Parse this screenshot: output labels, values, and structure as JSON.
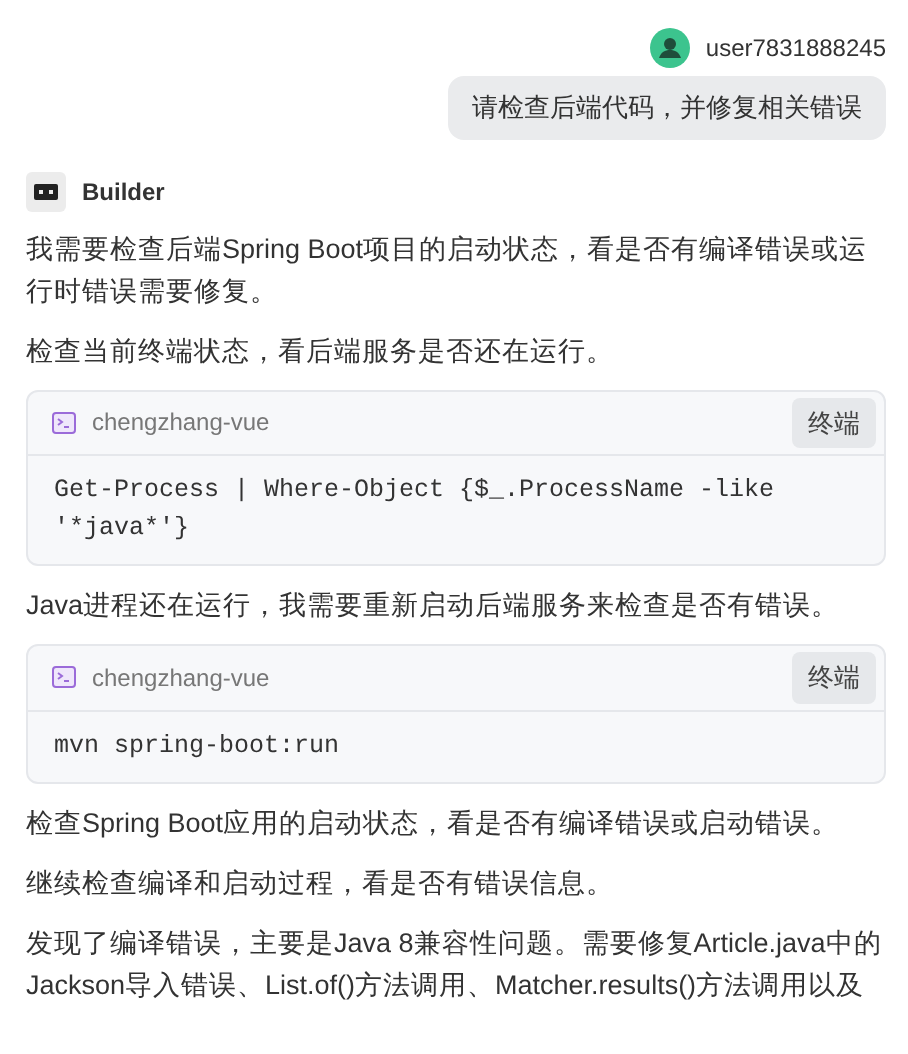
{
  "user": {
    "name": "user7831888245",
    "message": "请检查后端代码，并修复相关错误"
  },
  "assistant": {
    "name": "Builder"
  },
  "blocks": [
    {
      "kind": "text",
      "text": "我需要检查后端Spring Boot项目的启动状态，看是否有编译错误或运行时错误需要修复。"
    },
    {
      "kind": "text",
      "text": "检查当前终端状态，看后端服务是否还在运行。"
    },
    {
      "kind": "command",
      "project": "chengzhang-vue",
      "button": "终端",
      "code": "Get-Process | Where-Object {$_.ProcessName -like '*java*'}"
    },
    {
      "kind": "text",
      "text": "Java进程还在运行，我需要重新启动后端服务来检查是否有错误。"
    },
    {
      "kind": "command",
      "project": "chengzhang-vue",
      "button": "终端",
      "code": "mvn spring-boot:run"
    },
    {
      "kind": "text",
      "text": "检查Spring Boot应用的启动状态，看是否有编译错误或启动错误。"
    },
    {
      "kind": "text",
      "text": "继续检查编译和启动过程，看是否有错误信息。"
    },
    {
      "kind": "text",
      "text": "发现了编译错误，主要是Java 8兼容性问题。需要修复Article.java中的Jackson导入错误、List.of()方法调用、Matcher.results()方法调用以及"
    }
  ]
}
